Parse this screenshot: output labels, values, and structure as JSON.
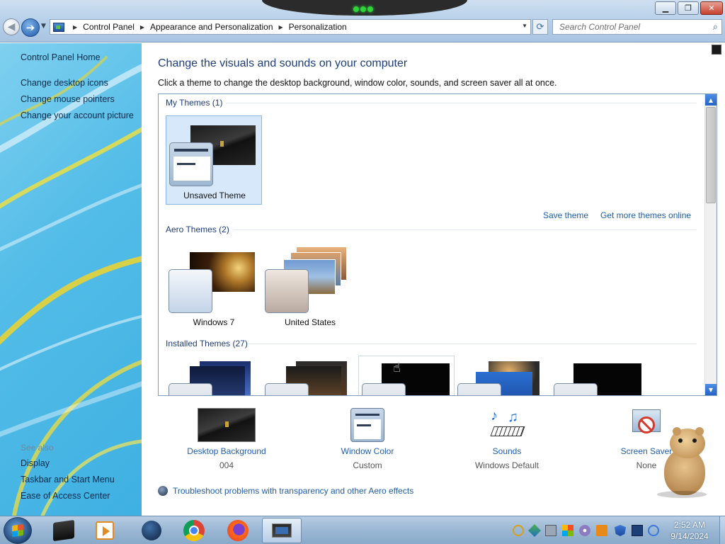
{
  "window": {
    "minimize_glyph": "▁",
    "maximize_glyph": "❐",
    "close_glyph": "✕"
  },
  "address": {
    "crumbs": [
      "Control Panel",
      "Appearance and Personalization",
      "Personalization"
    ]
  },
  "search": {
    "placeholder": "Search Control Panel"
  },
  "sidebar": {
    "home": "Control Panel Home",
    "tasks": [
      "Change desktop icons",
      "Change mouse pointers",
      "Change your account picture"
    ],
    "see_also_heading": "See also",
    "see_also": [
      "Display",
      "Taskbar and Start Menu",
      "Ease of Access Center"
    ]
  },
  "main": {
    "title": "Change the visuals and sounds on your computer",
    "description": "Click a theme to change the desktop background, window color, sounds, and screen saver all at once."
  },
  "themes": {
    "my_themes_heading": "My Themes (1)",
    "my_themes": [
      {
        "label": "Unsaved Theme",
        "selected": true
      }
    ],
    "save_theme": "Save theme",
    "get_more": "Get more themes online",
    "aero_heading": "Aero Themes (2)",
    "aero": [
      {
        "label": "Windows 7"
      },
      {
        "label": "United States"
      }
    ],
    "installed_heading": "Installed Themes (27)"
  },
  "quick_settings": [
    {
      "label": "Desktop Background",
      "value": "004",
      "icon": "desktop-background-icon"
    },
    {
      "label": "Window Color",
      "value": "Custom",
      "icon": "window-color-icon"
    },
    {
      "label": "Sounds",
      "value": "Windows Default",
      "icon": "sounds-icon"
    },
    {
      "label": "Screen Saver",
      "value": "None",
      "icon": "screen-saver-icon"
    }
  ],
  "troubleshoot": "Troubleshoot problems with transparency and other Aero effects",
  "taskbar": {
    "apps": [
      "terminal-app",
      "media-player-app",
      "globe-app",
      "chrome-app",
      "firefox-app",
      "control-panel-app"
    ],
    "clock_time": "2:52 AM",
    "clock_date": "9/14/2024"
  },
  "colors": {
    "heading_blue": "#1e3d7a",
    "link_blue": "#1f5ea8",
    "sidebar_cyan": "#54bde8",
    "selection": "#d6e8fa"
  }
}
